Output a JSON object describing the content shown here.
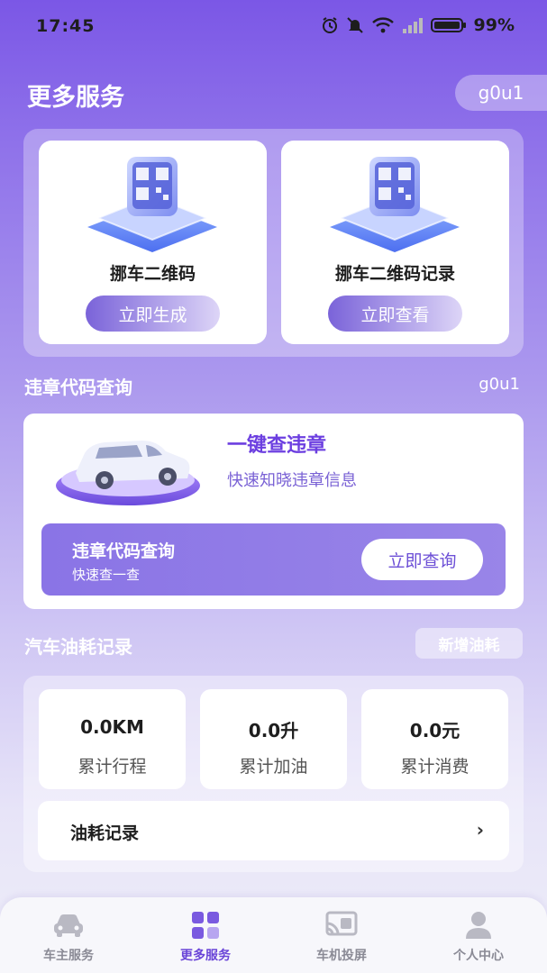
{
  "status_bar": {
    "time": "17:45",
    "battery": "99%",
    "icons": [
      "alarm-icon",
      "mute-icon",
      "wifi-icon",
      "signal-icon",
      "battery-icon"
    ]
  },
  "header": {
    "title": "更多服务",
    "user": "g0u1"
  },
  "qr_cards": [
    {
      "title": "挪车二维码",
      "button": "立即生成",
      "icon": "qr-platform-icon"
    },
    {
      "title": "挪车二维码记录",
      "button": "立即查看",
      "icon": "qr-platform-icon"
    }
  ],
  "violation": {
    "section_title": "违章代码查询",
    "section_user": "g0u1",
    "headline": "一键查违章",
    "subline": "快速知晓违章信息",
    "bar_title": "违章代码查询",
    "bar_sub": "快速查一查",
    "bar_button": "立即查询",
    "icon": "car-platform-icon"
  },
  "fuel": {
    "section_title": "汽车油耗记录",
    "add_button": "新增油耗",
    "stats": [
      {
        "value": "0.0KM",
        "label": "累计行程"
      },
      {
        "value": "0.0升",
        "label": "累计加油"
      },
      {
        "value": "0.0元",
        "label": "累计消费"
      }
    ],
    "record_label": "油耗记录",
    "record_chevron": "›"
  },
  "tabs": [
    {
      "label": "车主服务",
      "icon": "car-icon",
      "active": false
    },
    {
      "label": "更多服务",
      "icon": "grid-icon",
      "active": true
    },
    {
      "label": "车机投屏",
      "icon": "cast-icon",
      "active": false
    },
    {
      "label": "个人中心",
      "icon": "person-icon",
      "active": false
    }
  ],
  "colors": {
    "accent": "#6a45d8",
    "background_top": "#7b57e6",
    "tab_inactive": "#8a8a95"
  }
}
